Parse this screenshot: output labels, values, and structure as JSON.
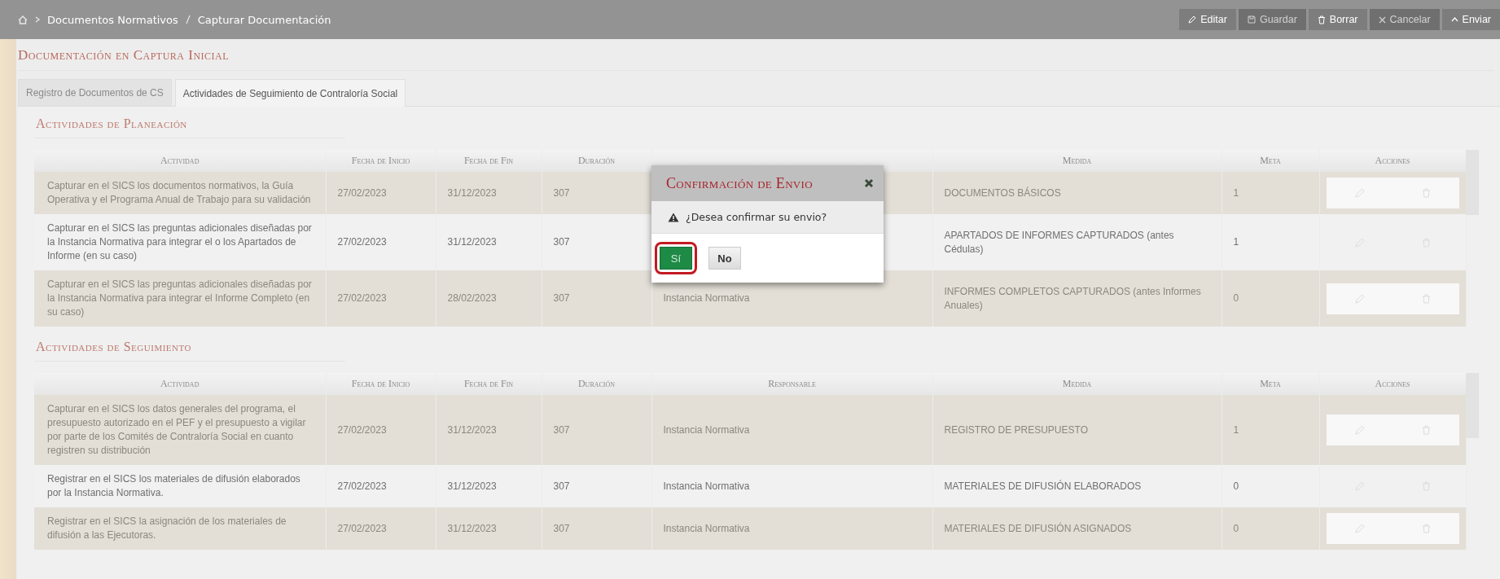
{
  "breadcrumb": [
    {
      "label": "Documentos Normativos"
    },
    {
      "label": "Capturar Documentación"
    }
  ],
  "toolbar": [
    {
      "kind": "edit",
      "label": "Editar",
      "disabled": false
    },
    {
      "kind": "save",
      "label": "Guardar",
      "disabled": true
    },
    {
      "kind": "delete",
      "label": "Borrar",
      "disabled": false
    },
    {
      "kind": "cancel",
      "label": "Cancelar",
      "disabled": true
    },
    {
      "kind": "send",
      "label": "Enviar",
      "disabled": false
    }
  ],
  "page_title": "Documentación en Captura Inicial",
  "tabs": [
    {
      "label": "Registro de Documentos de CS",
      "selected": false
    },
    {
      "label": "Actividades de Seguimiento de Contraloría Social",
      "selected": true
    }
  ],
  "sections": [
    {
      "title": "Actividades de Planeación",
      "columns": [
        {
          "label": "Actividad"
        },
        {
          "label": "Fecha de Inicio"
        },
        {
          "label": "Fecha de Fin"
        },
        {
          "label": "Duración"
        },
        {},
        {
          "label": "Medida"
        },
        {
          "label": "Meta"
        },
        {
          "label": "Acciones"
        }
      ],
      "rows": [
        {
          "actividad": "Capturar en el SICS los documentos normativos, la Guía Operativa y el Programa Anual de Trabajo para su validación",
          "fecha_inicio": "27/02/2023",
          "fecha_fin": "31/12/2023",
          "duracion": "307",
          "medida": "DOCUMENTOS BÁSICOS",
          "meta": "1"
        },
        {
          "actividad": "Capturar en el SICS las preguntas adicionales diseñadas por la Instancia Normativa para integrar el o los Apartados de Informe (en su caso)",
          "fecha_inicio": "27/02/2023",
          "fecha_fin": "31/12/2023",
          "duracion": "307",
          "medida": "APARTADOS DE INFORMES CAPTURADOS (antes Cédulas)",
          "meta": "1"
        },
        {
          "actividad": "Capturar en el SICS las preguntas adicionales diseñadas por la Instancia Normativa para integrar el Informe Completo (en su caso)",
          "fecha_inicio": "27/02/2023",
          "fecha_fin": "28/02/2023",
          "duracion": "307",
          "responsable": "Instancia Normativa",
          "medida": "INFORMES COMPLETOS CAPTURADOS (antes Informes Anuales)",
          "meta": "0"
        }
      ]
    },
    {
      "title": "Actividades de Seguimiento",
      "columns": [
        {
          "label": "Actividad"
        },
        {
          "label": "Fecha de Inicio"
        },
        {
          "label": "Fecha de Fin"
        },
        {
          "label": "Duración"
        },
        {
          "label": "Responsable"
        },
        {
          "label": "Medida"
        },
        {
          "label": "Meta"
        },
        {
          "label": "Acciones"
        }
      ],
      "rows": [
        {
          "actividad": "Capturar en el SICS los datos generales del programa, el presupuesto autorizado en el PEF y el presupuesto a vigilar por parte de los Comités de Contraloría Social en cuanto registren su distribución",
          "fecha_inicio": "27/02/2023",
          "fecha_fin": "31/12/2023",
          "duracion": "307",
          "responsable": "Instancia Normativa",
          "medida": "REGISTRO DE PRESUPUESTO",
          "meta": "1"
        },
        {
          "actividad": "Registrar en el SICS los materiales de difusión elaborados por la Instancia Normativa.",
          "fecha_inicio": "27/02/2023",
          "fecha_fin": "31/12/2023",
          "duracion": "307",
          "responsable": "Instancia Normativa",
          "medida": "MATERIALES DE DIFUSIÓN ELABORADOS",
          "meta": "0"
        },
        {
          "actividad": "Registrar en el SICS la asignación de los materiales de difusión a las Ejecutoras.",
          "fecha_inicio": "27/02/2023",
          "fecha_fin": "31/12/2023",
          "duracion": "307",
          "responsable": "Instancia Normativa",
          "medida": "MATERIALES DE DIFUSIÓN ASIGNADOS",
          "meta": "0"
        }
      ]
    }
  ],
  "dialog": {
    "title": "Confirmación de Envio",
    "message": "¿Desea confirmar su envio?",
    "buttons": [
      {
        "kind": "confirm",
        "label": "Sí",
        "highlighted": true
      },
      {
        "kind": "cancel",
        "label": "No",
        "highlighted": false
      }
    ]
  }
}
